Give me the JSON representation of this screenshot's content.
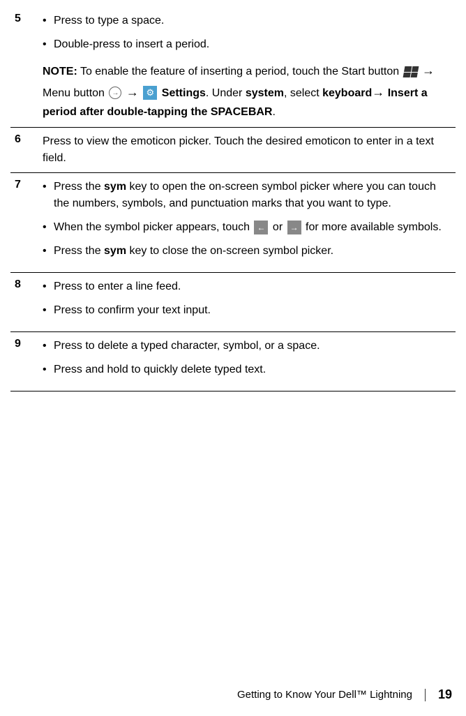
{
  "rows": {
    "5": {
      "num": "5",
      "bullet1": "Press to type a space.",
      "bullet2": "Double-press to insert a period.",
      "note_label": "NOTE:",
      "note_part1": " To enable the feature of inserting a period, touch the Start button ",
      "note_part2": " Menu button ",
      "note_part3_bold": "Settings",
      "note_part4": ". Under ",
      "note_part5_bold": "system",
      "note_part6": ", select ",
      "note_part7_bold": "keyboard",
      "note_part8_bold": " Insert a period after double-tapping the SPACEBAR",
      "note_part9": "."
    },
    "6": {
      "num": "6",
      "text": "Press to view the emoticon picker. Touch the desired emoticon to enter in a text field."
    },
    "7": {
      "num": "7",
      "bullet1_pre": "Press the ",
      "bullet1_bold": "sym",
      "bullet1_post": " key to open the on-screen symbol picker where you can touch the numbers, symbols, and punctuation marks that you want to type.",
      "bullet2_pre": "When the symbol picker appears, touch ",
      "bullet2_mid": " or ",
      "bullet2_post": " for more available symbols.",
      "bullet3_pre": "Press the ",
      "bullet3_bold": "sym",
      "bullet3_post": " key to close the on-screen symbol picker."
    },
    "8": {
      "num": "8",
      "bullet1": "Press to enter a line feed.",
      "bullet2": "Press to confirm your text input."
    },
    "9": {
      "num": "9",
      "bullet1": "Press to delete a typed character, symbol, or a space.",
      "bullet2": "Press and hold to quickly delete typed text."
    }
  },
  "arrow": "→",
  "footer": {
    "text": "Getting to Know Your Dell™ Lightning",
    "page": "19"
  }
}
